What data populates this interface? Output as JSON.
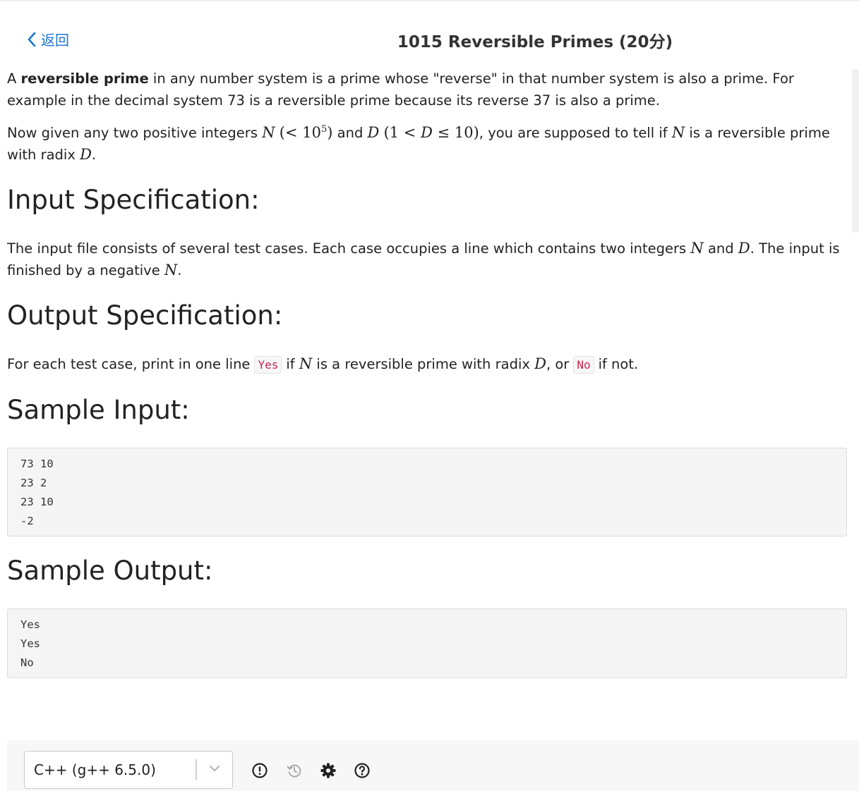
{
  "header": {
    "back_label": "返回",
    "title": "1015 Reversible Primes (20分)"
  },
  "problem": {
    "intro": {
      "t1": "A ",
      "bold": "reversible prime",
      "t2": " in any number system is a prime whose \"reverse\" in that number system is also a prime. For example in the decimal system 73 is a reversible prime because its reverse 37 is also a prime."
    },
    "given": {
      "t1": "Now given any two positive integers ",
      "m_n": "N",
      "m_lt_open": "(< 10",
      "m_exp": "5",
      "m_close": ")",
      "t2": " and ",
      "m_d": "D",
      "m_range_a": "(1 < ",
      "m_range_d": "D",
      "m_range_b": " ≤ 10)",
      "t3": ", you are supposed to tell if ",
      "m_n2": "N",
      "t4": " is a reversible prime with radix ",
      "m_d2": "D",
      "t5": "."
    },
    "input_heading": "Input Specification:",
    "input_text": {
      "t1": "The input file consists of several test cases. Each case occupies a line which contains two integers ",
      "m_n": "N",
      "t2": " and ",
      "m_d": "D",
      "t3": ". The input is finished by a negative ",
      "m_n2": "N",
      "t4": "."
    },
    "output_heading": "Output Specification:",
    "output_text": {
      "t1": "For each test case, print in one line",
      "code_yes": "Yes",
      "t2": "if ",
      "m_n": "N",
      "t3": " is a reversible prime with radix ",
      "m_d": "D",
      "t4": ", or",
      "code_no": "No",
      "t5": "if not."
    },
    "sample_input_heading": "Sample Input:",
    "sample_input": "73 10\n23 2\n23 10\n-2",
    "sample_output_heading": "Sample Output:",
    "sample_output": "Yes\nYes\nNo"
  },
  "editor": {
    "language_value": "C++ (g++ 6.5.0)",
    "icons": [
      "exclamation-circle-icon",
      "history-icon",
      "gear-icon",
      "question-circle-icon"
    ]
  },
  "colors": {
    "accent": "#1976d2",
    "inline_code": "#c7254e",
    "code_bg": "#f5f5f5"
  }
}
